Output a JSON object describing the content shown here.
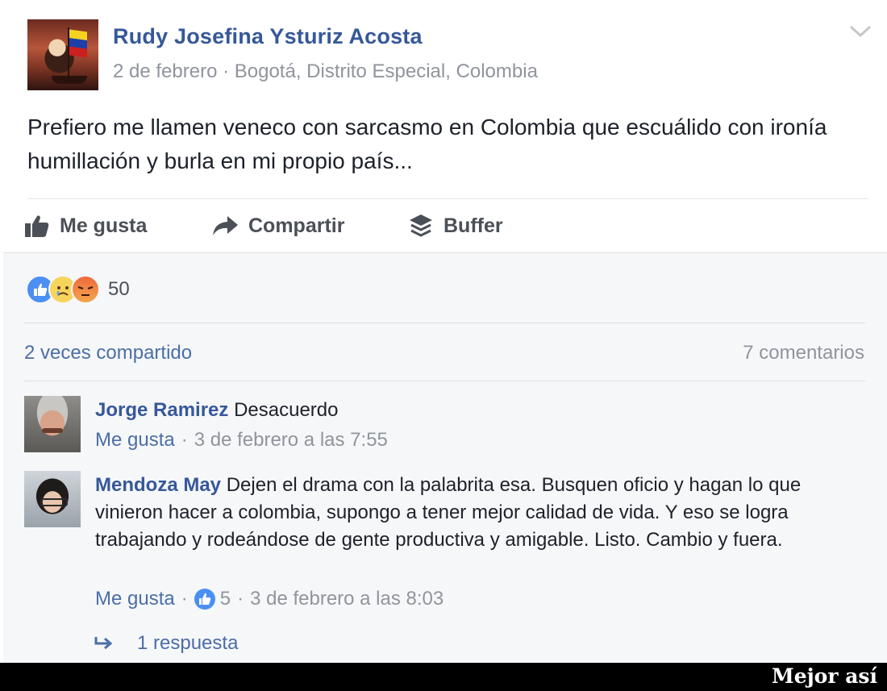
{
  "post": {
    "author": "Rudy Josefina Ysturiz Acosta",
    "meta": "2 de febrero · Bogotá, Distrito Especial, Colombia",
    "text": "Prefiero me llamen veneco con sarcasmo en Colombia que escuálido con ironía humillación y burla en mi propio país...",
    "actions": {
      "like": "Me gusta",
      "share": "Compartir",
      "buffer": "Buffer"
    },
    "reactions_count": "50",
    "shares_text": "2 veces compartido",
    "comments_text": "7 comentarios",
    "icons": [
      "chevron-down-icon",
      "thumbs-up-icon",
      "share-arrow-icon",
      "buffer-stack-icon",
      "like-reaction-icon",
      "sad-reaction-icon",
      "angry-reaction-icon",
      "reply-arrow-icon"
    ],
    "colors": {
      "link_blue": "#365899",
      "meta_gray": "#90949c",
      "like_blue": "#4b8ff2",
      "panel_bg": "#f6f7f9"
    }
  },
  "comments": [
    {
      "author": "Jorge Ramirez",
      "text": "Desacuerdo",
      "like_label": "Me gusta",
      "time": "3 de febrero a las 7:55"
    },
    {
      "author": "Mendoza May",
      "text": "Dejen el drama con la palabrita esa. Busquen oficio y hagan lo que vinieron hacer a colombia, supongo a tener mejor calidad de vida. Y eso se logra trabajando y rodeándose de gente productiva y amigable. Listo. Cambio y fuera.",
      "like_label": "Me gusta",
      "likes": "5",
      "time": "3 de febrero a las 8:03"
    }
  ],
  "reply_text": "1 respuesta",
  "caption": "Mejor así"
}
